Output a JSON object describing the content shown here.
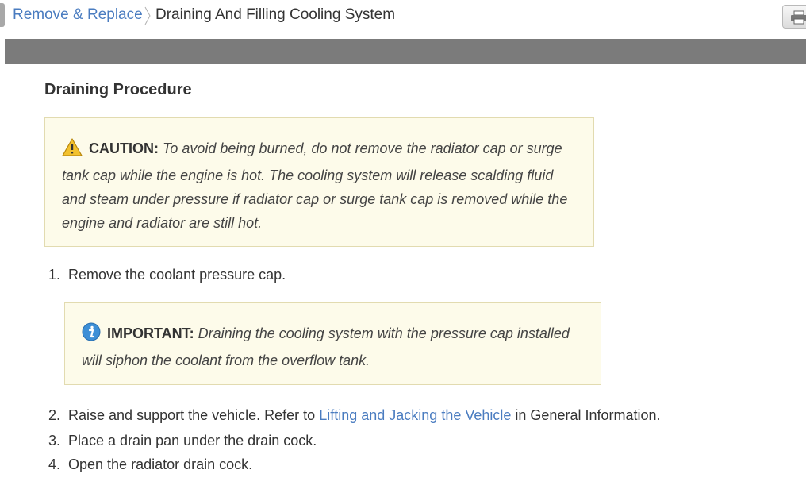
{
  "breadcrumb": {
    "parent": "Remove & Replace",
    "current": "Draining And Filling Cooling System"
  },
  "toolbar": {
    "print_icon": "printer-icon"
  },
  "section": {
    "title": "Draining Procedure"
  },
  "caution": {
    "icon": "warning-triangle-icon",
    "label": "CAUTION:",
    "text": "To avoid being burned, do not remove the radiator cap or surge tank cap while the engine is hot. The cooling system will release scalding fluid and steam under pressure if radiator cap or surge tank cap is removed while the engine and radiator are still hot."
  },
  "important": {
    "icon": "info-icon",
    "label": "IMPORTANT:",
    "text": "Draining the cooling system with the pressure cap installed will siphon the coolant from the overflow tank."
  },
  "steps": [
    {
      "num": "1.",
      "text": "Remove the coolant pressure cap."
    },
    {
      "num": "2.",
      "text_before": "Raise and support the vehicle. Refer to",
      "link": "Lifting and Jacking the Vehicle",
      "text_after": "in General Information."
    },
    {
      "num": "3.",
      "text": "Place a drain pan under the drain cock."
    },
    {
      "num": "4.",
      "text": "Open the radiator drain cock."
    }
  ],
  "colors": {
    "link": "#4a7cc0",
    "notice_bg": "#fdfbea",
    "notice_border": "#e2dbb0",
    "bar": "#7b7b7b"
  }
}
